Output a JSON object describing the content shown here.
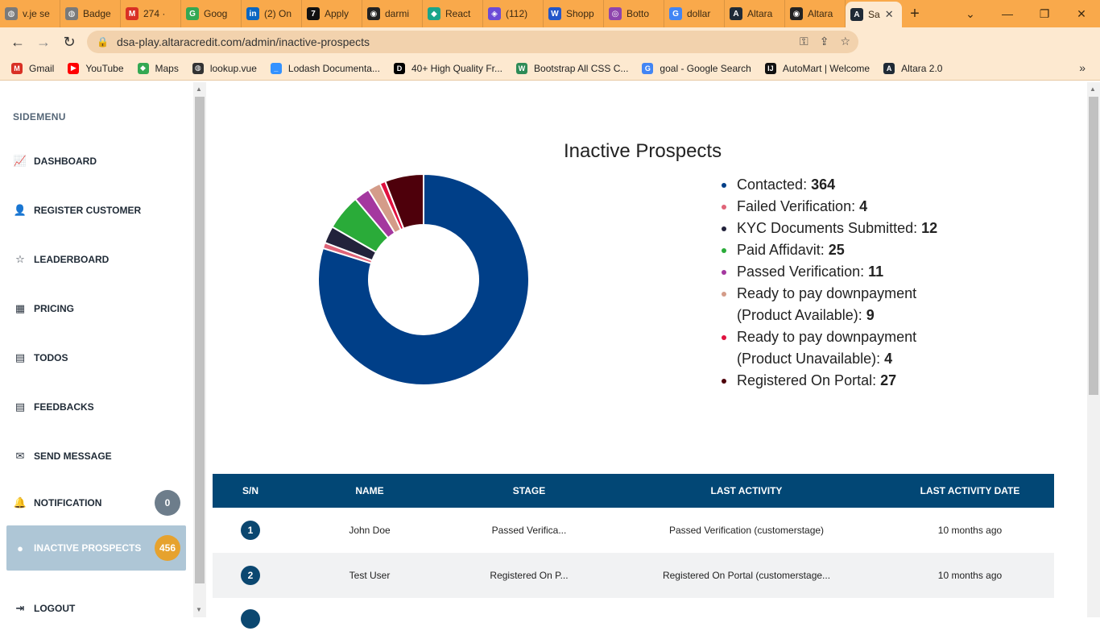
{
  "browser": {
    "tabs": [
      {
        "label": "v.je se",
        "color": "#7a7a7a",
        "glyph": "◍"
      },
      {
        "label": "Badge",
        "color": "#7a7a7a",
        "glyph": "◍"
      },
      {
        "label": "274 ·",
        "color": "#d93025",
        "glyph": "M"
      },
      {
        "label": "Goog",
        "color": "#34a853",
        "glyph": "G"
      },
      {
        "label": "(2) On",
        "color": "#0a66c2",
        "glyph": "in"
      },
      {
        "label": "Apply",
        "color": "#111111",
        "glyph": "7"
      },
      {
        "label": "darmi",
        "color": "#222222",
        "glyph": "◉"
      },
      {
        "label": "React",
        "color": "#1aa58a",
        "glyph": "◆"
      },
      {
        "label": "(112)",
        "color": "#6c4bd6",
        "glyph": "◈"
      },
      {
        "label": "Shopp",
        "color": "#2356c9",
        "glyph": "W"
      },
      {
        "label": "Botto",
        "color": "#8e44ad",
        "glyph": "◎"
      },
      {
        "label": "dollar",
        "color": "#4285f4",
        "glyph": "G"
      },
      {
        "label": "Altara",
        "color": "#1f2a36",
        "glyph": "A"
      },
      {
        "label": "Altara",
        "color": "#222222",
        "glyph": "◉"
      },
      {
        "label": "Sa",
        "color": "#1f2a36",
        "glyph": "A"
      }
    ],
    "active_tab_index": 14,
    "url": "dsa-play.altaracredit.com/admin/inactive-prospects",
    "bookmarks": [
      {
        "label": "Gmail",
        "color": "#d93025",
        "glyph": "M"
      },
      {
        "label": "YouTube",
        "color": "#ff0000",
        "glyph": "▶"
      },
      {
        "label": "Maps",
        "color": "#34a853",
        "glyph": "◆"
      },
      {
        "label": "lookup.vue",
        "color": "#333333",
        "glyph": "◍"
      },
      {
        "label": "Lodash Documenta...",
        "color": "#3492ff",
        "glyph": "_"
      },
      {
        "label": "40+ High Quality Fr...",
        "color": "#000000",
        "glyph": "D"
      },
      {
        "label": "Bootstrap All CSS C...",
        "color": "#2e8b57",
        "glyph": "W"
      },
      {
        "label": "goal - Google Search",
        "color": "#4285f4",
        "glyph": "G"
      },
      {
        "label": "AutoMart | Welcome",
        "color": "#111111",
        "glyph": "IJ"
      },
      {
        "label": "Altara 2.0",
        "color": "#1f2a36",
        "glyph": "A"
      }
    ]
  },
  "sidebar": {
    "heading": "SIDEMENU",
    "items": [
      {
        "label": "DASHBOARD",
        "icon": "chart-line-icon",
        "glyph": "📈"
      },
      {
        "label": "REGISTER CUSTOMER",
        "icon": "user-plus-icon",
        "glyph": "👤"
      },
      {
        "label": "LEADERBOARD",
        "icon": "star-icon",
        "glyph": "☆"
      },
      {
        "label": "PRICING",
        "icon": "calculator-icon",
        "glyph": "▦"
      },
      {
        "label": "TODOS",
        "icon": "clipboard-icon",
        "glyph": "▤"
      },
      {
        "label": "FEEDBACKS",
        "icon": "clipboard-icon",
        "glyph": "▤"
      },
      {
        "label": "SEND MESSAGE",
        "icon": "envelope-icon",
        "glyph": "✉"
      },
      {
        "label": "NOTIFICATION",
        "icon": "bell-icon",
        "glyph": "🔔",
        "badge": "0",
        "badge_color": "#6d7d8b"
      },
      {
        "label": "INACTIVE PROSPECTS",
        "icon": "user-circle-icon",
        "glyph": "●",
        "badge": "456",
        "badge_color": "#e6a22e",
        "active": true
      },
      {
        "label": "LOGOUT",
        "icon": "logout-icon",
        "glyph": "⇥"
      }
    ]
  },
  "chart": {
    "title": "Inactive Prospects"
  },
  "chart_data": {
    "type": "pie",
    "title": "Inactive Prospects",
    "legend_placement": "right",
    "series": [
      {
        "name": "Contacted",
        "value": 364,
        "color": "#003f88"
      },
      {
        "name": "Failed Verification",
        "value": 4,
        "color": "#e06478"
      },
      {
        "name": "KYC Documents Submitted",
        "value": 12,
        "color": "#22223b"
      },
      {
        "name": "Paid Affidavit",
        "value": 25,
        "color": "#2aab39"
      },
      {
        "name": "Passed Verification",
        "value": 11,
        "color": "#a4389f"
      },
      {
        "name": "Ready to pay downpayment (Product Available)",
        "value": 9,
        "color": "#d49c89"
      },
      {
        "name": "Ready to pay downpayment (Product Unavailable)",
        "value": 4,
        "color": "#e0113f"
      },
      {
        "name": "Registered On Portal",
        "value": 27,
        "color": "#4e000b"
      }
    ]
  },
  "table": {
    "headers": [
      "S/N",
      "NAME",
      "STAGE",
      "LAST ACTIVITY",
      "LAST ACTIVITY DATE"
    ],
    "rows": [
      {
        "sn": "1",
        "name": "John Doe",
        "stage": "Passed Verifica...",
        "last_activity": "Passed Verification (customerstage)",
        "date": "10 months ago"
      },
      {
        "sn": "2",
        "name": "Test User",
        "stage": "Registered On P...",
        "last_activity": "Registered On Portal (customerstage...",
        "date": "10 months ago"
      }
    ]
  }
}
